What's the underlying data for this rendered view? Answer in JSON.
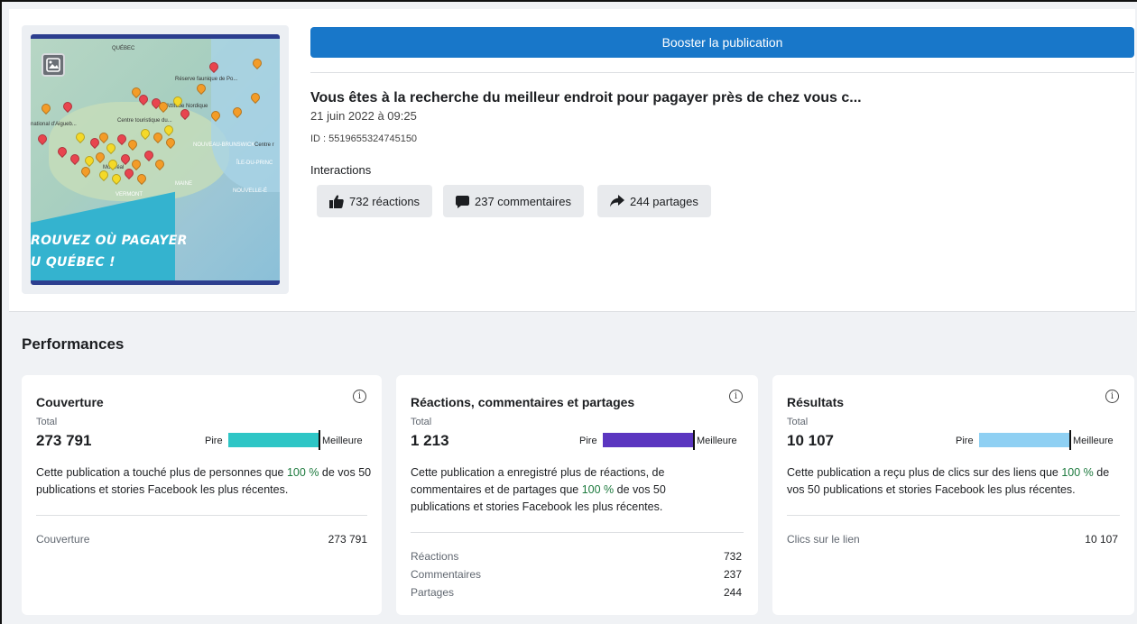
{
  "thumbnail": {
    "map_labels": [
      "QUÉBEC",
      "Réserve faunique de Po...",
      "Attitude Nordique",
      "Centre touristique du...",
      "national d'Aigueb...",
      "NOUVEAU-BRUNSWICK",
      "Centre r",
      "ÎLE-DU-PRINC",
      "MAINE",
      "NOUVELLE-É",
      "VERMONT",
      "Montréal"
    ],
    "slogan_line1": "ROUVEZ OÙ PAGAYER",
    "slogan_line2": "U QUÉBEC !"
  },
  "post": {
    "boost_label": "Booster la publication",
    "title": "Vous êtes à la recherche du meilleur endroit pour pagayer près de chez vous c...",
    "date": "21 juin 2022 à 09:25",
    "id": "ID : 5519655324745150",
    "interactions_heading": "Interactions",
    "reactions": "732 réactions",
    "comments": "237 commentaires",
    "shares": "244 partages"
  },
  "performances": {
    "heading": "Performances",
    "cards": [
      {
        "title": "Couverture",
        "total_label": "Total",
        "total": "273 791",
        "worse": "Pire",
        "better": "Meilleure",
        "bar_color": "#2ec6c6",
        "desc_before": "Cette publication a touché plus de personnes que ",
        "pct": "100 %",
        "desc_after": " de vos 50 publications et stories Facebook les plus récentes.",
        "rows": [
          {
            "label": "Couverture",
            "value": "273 791"
          }
        ]
      },
      {
        "title": "Réactions, commentaires et partages",
        "total_label": "Total",
        "total": "1 213",
        "worse": "Pire",
        "better": "Meilleure",
        "bar_color": "#5b36c0",
        "desc_before": "Cette publication a enregistré plus de réactions, de commentaires et de partages que ",
        "pct": "100 %",
        "desc_after": " de vos 50 publications et stories Facebook les plus récentes.",
        "rows": [
          {
            "label": "Réactions",
            "value": "732"
          },
          {
            "label": "Commentaires",
            "value": "237"
          },
          {
            "label": "Partages",
            "value": "244"
          }
        ]
      },
      {
        "title": "Résultats",
        "total_label": "Total",
        "total": "10 107",
        "worse": "Pire",
        "better": "Meilleure",
        "bar_color": "#8fd0f3",
        "desc_before": "Cette publication a reçu plus de clics sur des liens que ",
        "pct": "100 %",
        "desc_after": " de vos 50 publications et stories Facebook les plus récentes.",
        "rows": [
          {
            "label": "Clics sur le lien",
            "value": "10 107"
          }
        ]
      }
    ]
  },
  "icons": {
    "image": "image-icon",
    "like": "thumbs-up-icon",
    "comment": "comment-bubble-icon",
    "share": "share-arrow-icon",
    "info": "info-icon"
  }
}
